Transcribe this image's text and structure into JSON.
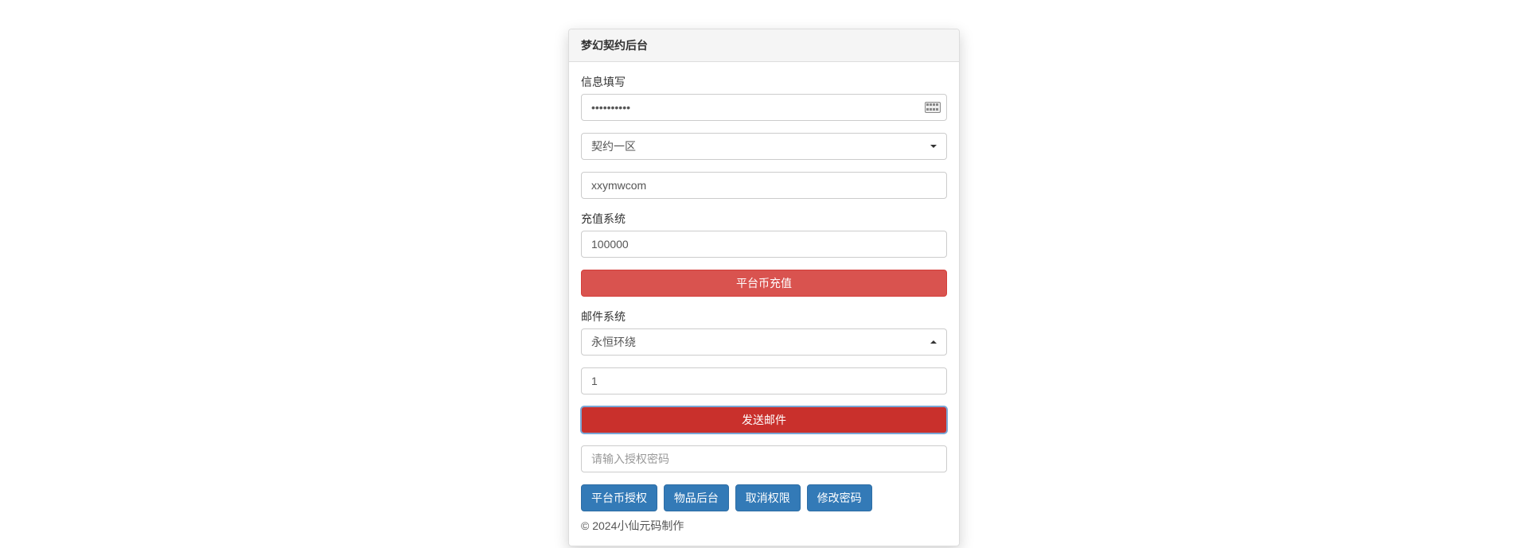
{
  "panel": {
    "title": "梦幻契约后台"
  },
  "info": {
    "label": "信息填写",
    "password_value": "●●●●●●●●●●",
    "zone_select_value": "契约一区",
    "account_value": "xxymwcom"
  },
  "recharge": {
    "label": "充值系统",
    "amount_value": "100000",
    "button_label": "平台币充值"
  },
  "mail": {
    "label": "邮件系统",
    "item_select_value": "永恒环绕",
    "qty_value": "1",
    "button_label": "发送邮件"
  },
  "auth": {
    "placeholder": "请输入授权密码"
  },
  "buttons": {
    "authorize": "平台币授权",
    "item_admin": "物品后台",
    "cancel_perm": "取消权限",
    "change_pwd": "修改密码"
  },
  "footer": {
    "text": "© 2024小仙元码制作"
  }
}
